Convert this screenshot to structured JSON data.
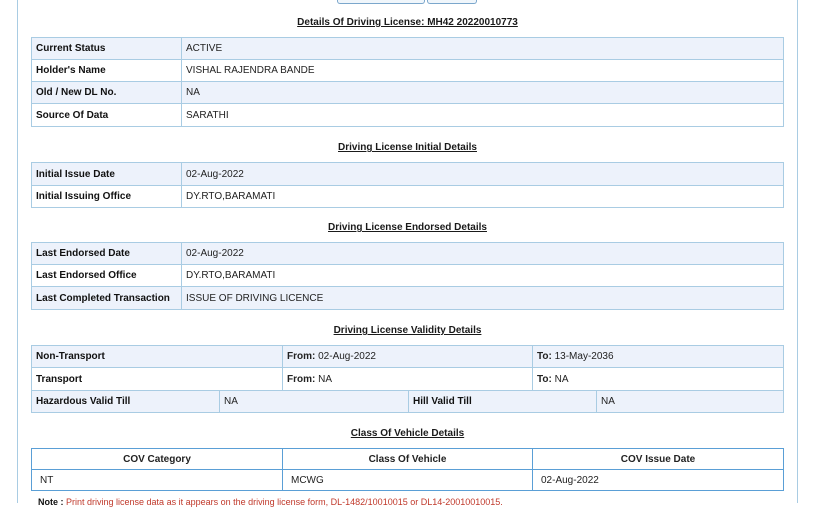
{
  "title": "Details Of Driving License: MH42 20220010773",
  "basic": [
    {
      "label": "Current Status",
      "value": "ACTIVE"
    },
    {
      "label": "Holder's Name",
      "value": "VISHAL RAJENDRA BANDE"
    },
    {
      "label": "Old / New DL No.",
      "value": "NA"
    },
    {
      "label": "Source Of Data",
      "value": "SARATHI"
    }
  ],
  "initial": {
    "heading": "Driving License Initial Details",
    "rows": [
      {
        "label": "Initial Issue Date",
        "value": "02-Aug-2022"
      },
      {
        "label": "Initial Issuing Office",
        "value": "DY.RTO,BARAMATI"
      }
    ]
  },
  "endorsed": {
    "heading": "Driving License Endorsed Details",
    "rows": [
      {
        "label": "Last Endorsed Date",
        "value": "02-Aug-2022"
      },
      {
        "label": "Last Endorsed Office",
        "value": "DY.RTO,BARAMATI"
      },
      {
        "label": "Last Completed Transaction",
        "value": "ISSUE OF DRIVING LICENCE"
      }
    ]
  },
  "validity": {
    "heading": "Driving License Validity Details",
    "non_transport": {
      "label": "Non-Transport",
      "from_label": "From:",
      "from": "02-Aug-2022",
      "to_label": "To:",
      "to": "13-May-2036"
    },
    "transport": {
      "label": "Transport",
      "from_label": "From:",
      "from": "NA",
      "to_label": "To:",
      "to": "NA"
    },
    "hazardous": {
      "label": "Hazardous Valid Till",
      "value": "NA"
    },
    "hill": {
      "label": "Hill Valid Till",
      "value": "NA"
    }
  },
  "cov": {
    "heading": "Class Of Vehicle Details",
    "columns": [
      "COV Category",
      "Class Of Vehicle",
      "COV Issue Date"
    ],
    "rows": [
      [
        "NT",
        "MCWG",
        "02-Aug-2022"
      ]
    ]
  },
  "note": {
    "label": "Note :",
    "text": "Print driving license data as it appears on the driving license form, DL-1482/10010015 or DL14-20010010015."
  }
}
